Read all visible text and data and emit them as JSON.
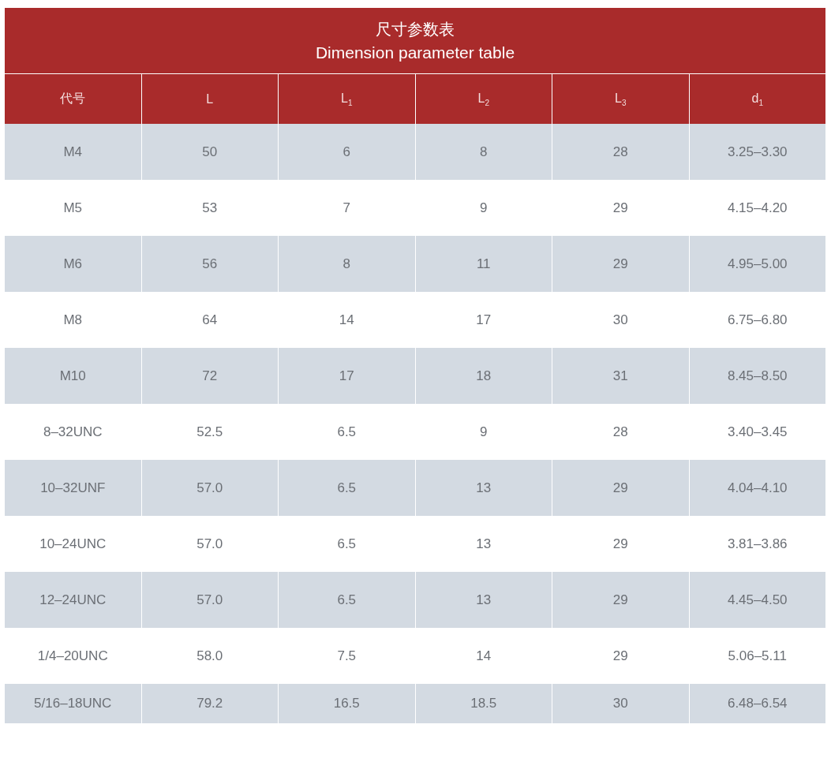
{
  "title": "尺寸参数表",
  "subtitle": "Dimension parameter table",
  "columns": [
    "代号",
    "L",
    "L$_{1}$",
    "L$_{2}$",
    "L$_{3}$",
    "d$_{1}$"
  ],
  "rows": [
    [
      "M4",
      "50",
      "6",
      "8",
      "28",
      "3.25–3.30"
    ],
    [
      "M5",
      "53",
      "7",
      "9",
      "29",
      "4.15–4.20"
    ],
    [
      "M6",
      "56",
      "8",
      "11",
      "29",
      "4.95–5.00"
    ],
    [
      "M8",
      "64",
      "14",
      "17",
      "30",
      "6.75–6.80"
    ],
    [
      "M10",
      "72",
      "17",
      "18",
      "31",
      "8.45–8.50"
    ],
    [
      "8–32UNC",
      "52.5",
      "6.5",
      "9",
      "28",
      "3.40–3.45"
    ],
    [
      "10–32UNF",
      "57.0",
      "6.5",
      "13",
      "29",
      "4.04–4.10"
    ],
    [
      "10–24UNC",
      "57.0",
      "6.5",
      "13",
      "29",
      "3.81–3.86"
    ],
    [
      "12–24UNC",
      "57.0",
      "6.5",
      "13",
      "29",
      "4.45–4.50"
    ],
    [
      "1/4–20UNC",
      "58.0",
      "7.5",
      "14",
      "29",
      "5.06–5.11"
    ],
    [
      "5/16–18UNC",
      "79.2",
      "16.5",
      "18.5",
      "30",
      "6.48–6.54"
    ]
  ]
}
